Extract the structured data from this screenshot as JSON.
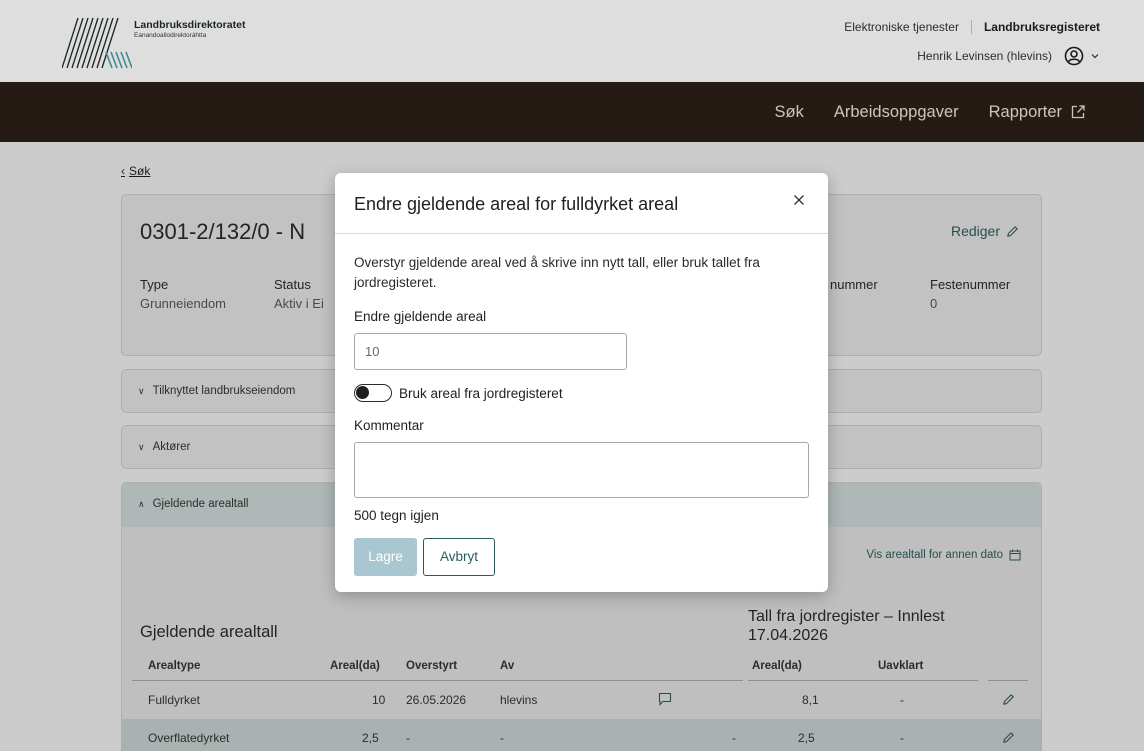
{
  "header": {
    "logo_title": "Landbruksdirektoratet",
    "logo_subtitle": "Eanandoallodirektoráhtta",
    "link_services": "Elektroniske tjenester",
    "link_register": "Landbruksregisteret",
    "user": "Henrik Levinsen (hlevins)"
  },
  "nav": {
    "items": [
      "Søk",
      "Arbeidsoppgaver",
      "Rapporter"
    ]
  },
  "page": {
    "back_link": "Søk",
    "property_title": "0301-2/132/0 - N",
    "edit_label": "Rediger",
    "fields": {
      "type_label": "Type",
      "type_value": "Grunneiendom",
      "status_label": "Status",
      "status_value": "Aktiv i Ei",
      "number_label": "nummer",
      "feste_label": "Festenummer",
      "feste_value": "0"
    },
    "accordions": [
      "Tilknyttet landbrukseiendom",
      "Aktører",
      "Gjeldende arealtall"
    ],
    "vis_arealtall": "Vis arealtall for annen dato",
    "section_left_title": "Gjeldende arealtall",
    "section_right_title": "Tall fra jordregister – Innlest 17.04.2026",
    "table": {
      "headers": [
        "Arealtype",
        "Areal(da)",
        "Overstyrt",
        "Av",
        "Areal(da)",
        "Uavklart"
      ],
      "rows": [
        [
          "Fulldyrket",
          "10",
          "26.05.2026",
          "hlevins",
          "8,1",
          "-"
        ],
        [
          "Overflatedyrket",
          "2,5",
          "-",
          "-",
          "-",
          "2,5",
          "-"
        ]
      ]
    }
  },
  "modal": {
    "title": "Endre gjeldende areal for fulldyrket areal",
    "description": "Overstyr gjeldende areal ved å skrive inn nytt tall, eller bruk tallet fra jordregisteret.",
    "area_label": "Endre gjeldende areal",
    "area_value": "10",
    "toggle_label": "Bruk areal fra jordregisteret",
    "comment_label": "Kommentar",
    "remaining": "500 tegn igjen",
    "save_label": "Lagre",
    "cancel_label": "Avbryt"
  },
  "colors": {
    "nav_bg": "#2b2018",
    "accent": "#2c5a5a",
    "save_disabled": "#a9c7d1"
  }
}
